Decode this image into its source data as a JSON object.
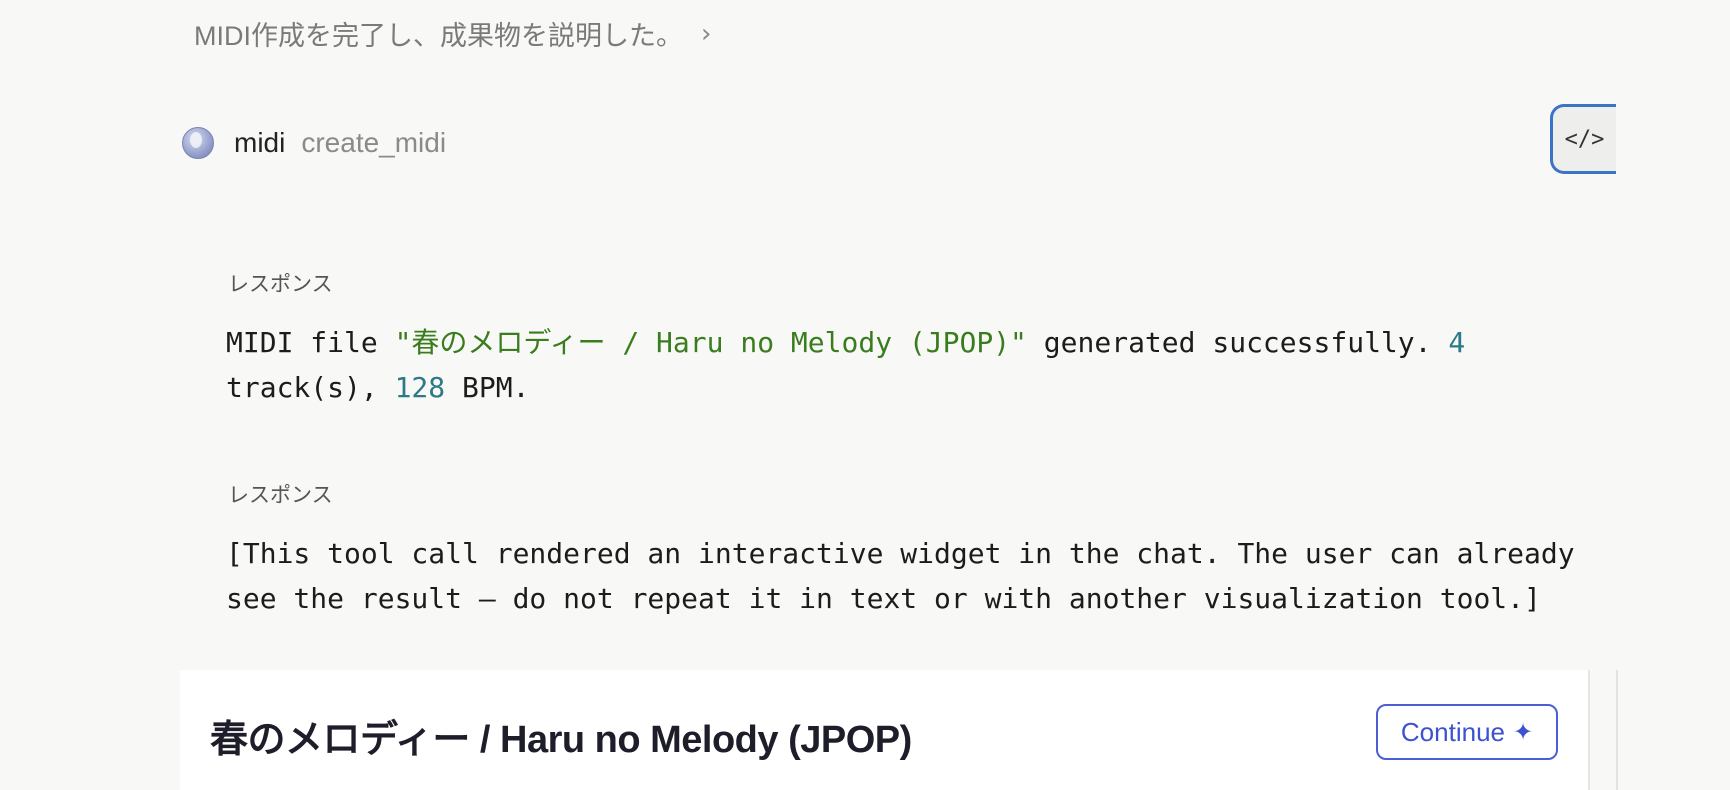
{
  "summary": {
    "text": "MIDI作成を完了し、成果物を説明した。",
    "chevron": "›"
  },
  "tool": {
    "icon": "globe-icon",
    "name": "midi",
    "function": "create_midi",
    "code_button_label": "</>"
  },
  "responses": [
    {
      "label": "レスポンス",
      "parts": [
        {
          "text": "MIDI file ",
          "type": "plain"
        },
        {
          "text": "\"春のメロディー / Haru no Melody (JPOP)\"",
          "type": "string"
        },
        {
          "text": " generated successfully. ",
          "type": "plain"
        },
        {
          "text": "4",
          "type": "number"
        },
        {
          "text": " track(s), ",
          "type": "plain"
        },
        {
          "text": "128",
          "type": "number"
        },
        {
          "text": " BPM.",
          "type": "plain"
        }
      ]
    },
    {
      "label": "レスポンス",
      "text": "[This tool call rendered an interactive widget in the chat. The user can already see the result — do not repeat it in text or with another visualization tool.]"
    }
  ],
  "card": {
    "title": "春のメロディー / Haru no Melody (JPOP)",
    "continue_label": "Continue",
    "continue_icon": "✦"
  },
  "colors": {
    "string": "#3a7d1f",
    "number": "#2b7a86",
    "accent": "#3c52d0",
    "focus": "#3b73c6"
  }
}
